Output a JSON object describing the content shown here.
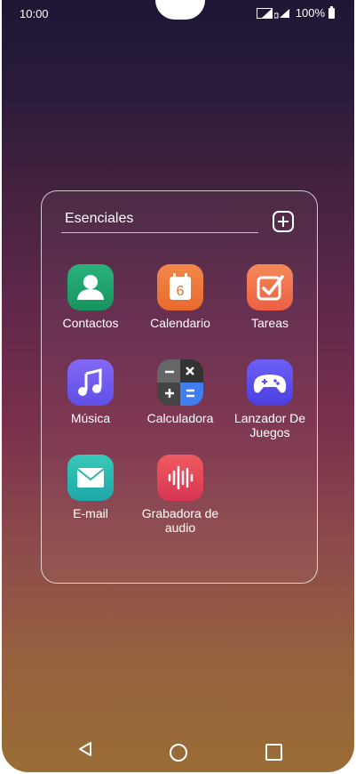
{
  "status": {
    "time": "10:00",
    "battery": "100%"
  },
  "folder": {
    "title": "Esenciales",
    "apps": [
      {
        "label": "Contactos",
        "icon": "contacts-icon",
        "color": "#1fa36f"
      },
      {
        "label": "Calendario",
        "icon": "calendar-icon",
        "color": "#f07a3a",
        "day": "6"
      },
      {
        "label": "Tareas",
        "icon": "tasks-icon",
        "color": "#f26b4e"
      },
      {
        "label": "Música",
        "icon": "music-icon",
        "color": "#6c5cf0"
      },
      {
        "label": "Calculadora",
        "icon": "calculator-icon",
        "color": "#5a5a5a"
      },
      {
        "label": "Lanzador De Juegos",
        "icon": "game-launcher-icon",
        "color": "#5b4cf2"
      },
      {
        "label": "E-mail",
        "icon": "email-icon",
        "color": "#2db8b0"
      },
      {
        "label": "Grabadora de audio",
        "icon": "audio-recorder-icon",
        "color": "#e34858"
      }
    ]
  }
}
